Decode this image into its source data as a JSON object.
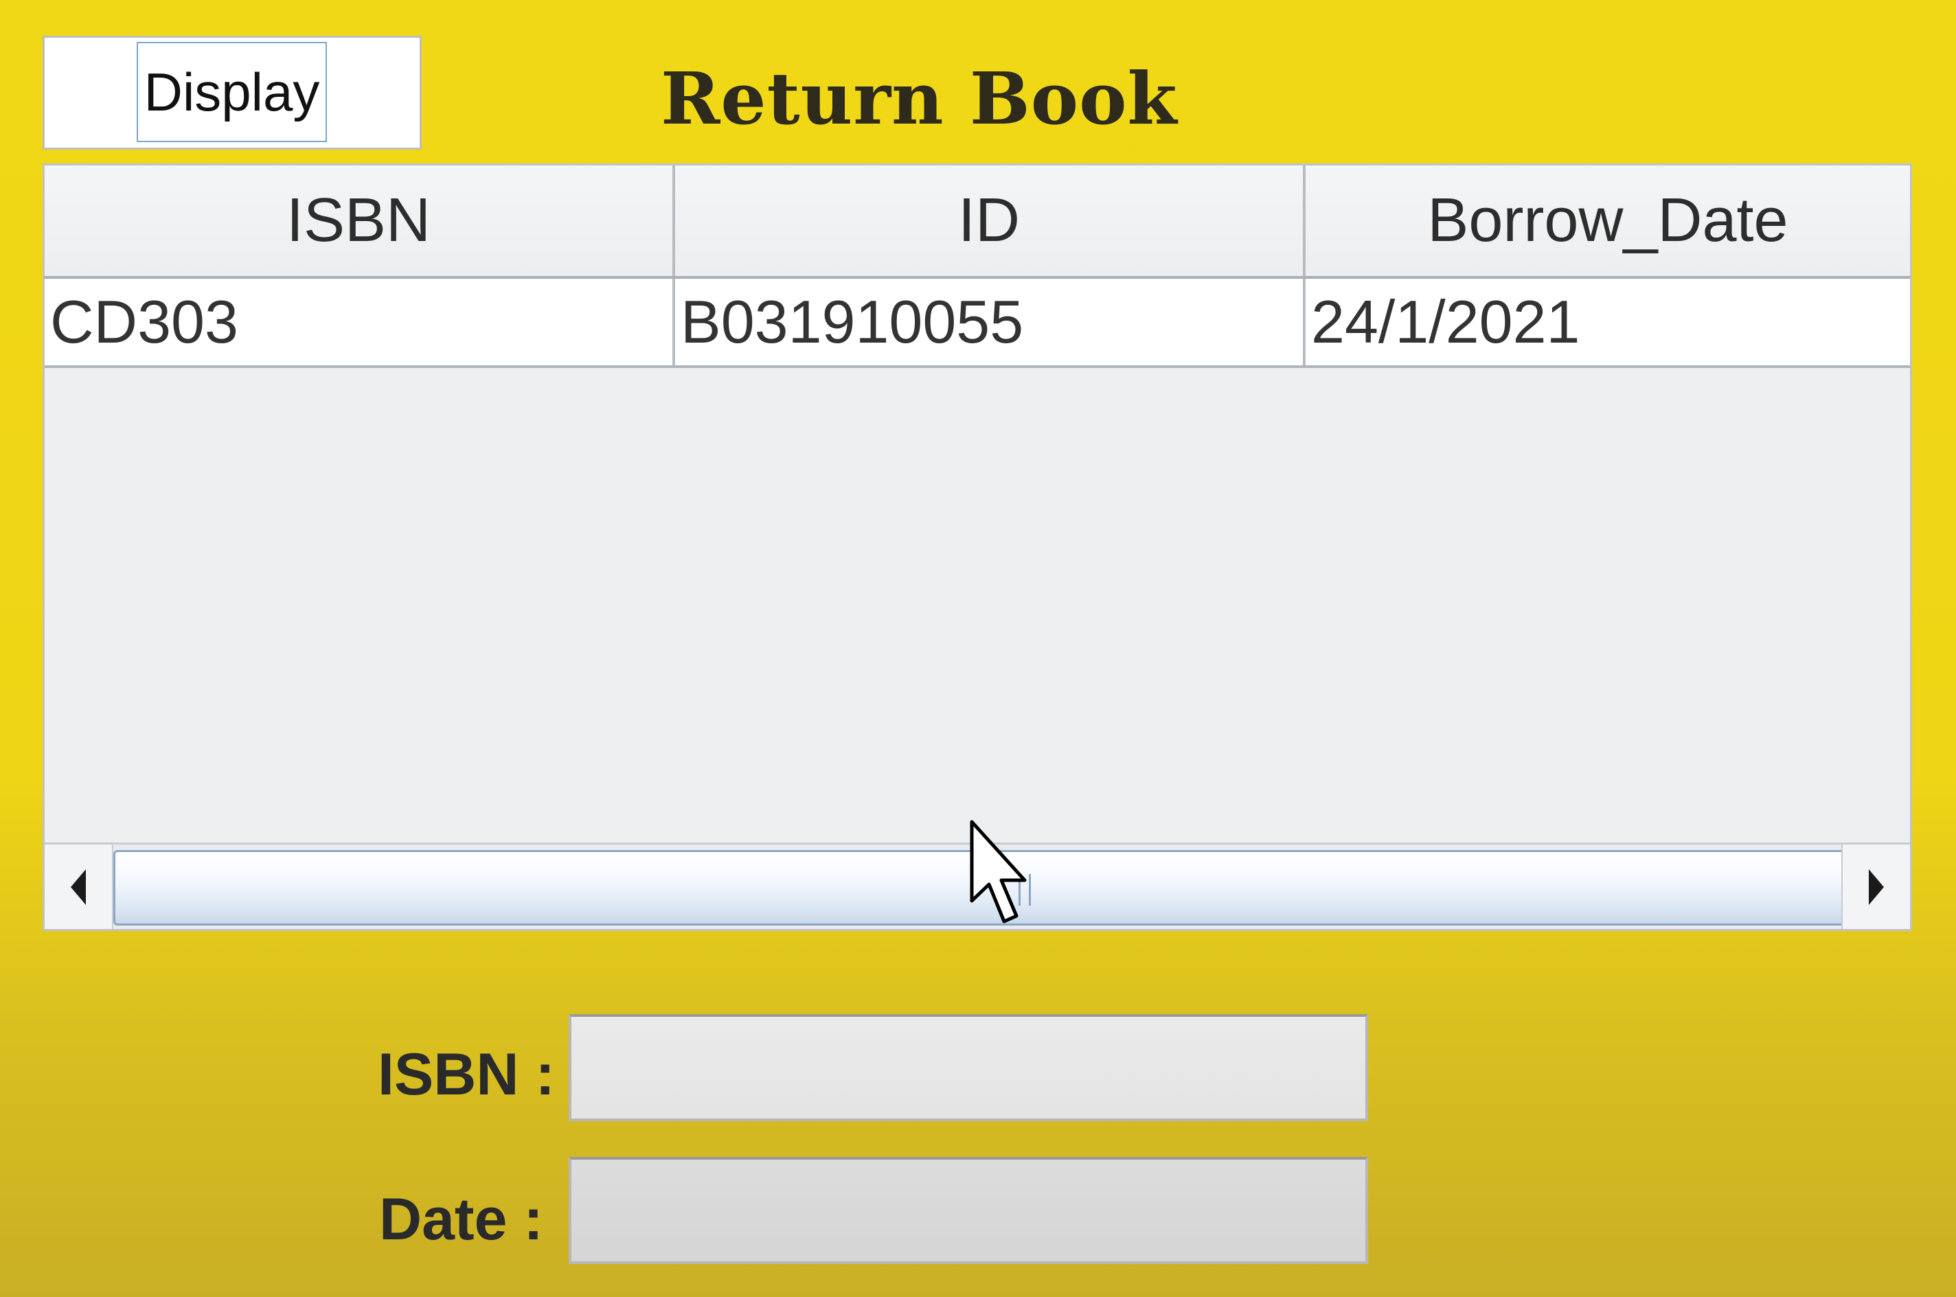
{
  "toolbar": {
    "display_label": "Display"
  },
  "page": {
    "title": "Return Book"
  },
  "table": {
    "columns": [
      "ISBN",
      "ID",
      "Borrow_Date"
    ],
    "rows": [
      [
        "CD303",
        "B031910055",
        "24/1/2021"
      ]
    ]
  },
  "form": {
    "isbn_label": "ISBN :",
    "isbn_value": "",
    "date_label": "Date :",
    "date_value": ""
  },
  "icons": {
    "scroll_left": "triangle-left-icon",
    "scroll_right": "triangle-right-icon",
    "cursor": "mouse-pointer-icon"
  },
  "colors": {
    "background": "#f1d817",
    "title": "#2e2a1c",
    "table_background": "#eeeff1",
    "scroll_thumb_border": "#8da6c4"
  }
}
